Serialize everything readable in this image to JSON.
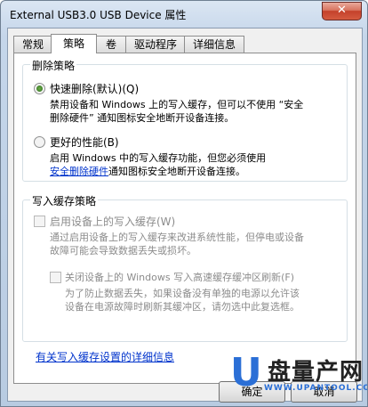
{
  "window": {
    "title": "External USB3.0 USB Device 属性",
    "close_glyph": "✕"
  },
  "tabs": [
    {
      "label": "常规"
    },
    {
      "label": "策略"
    },
    {
      "label": "卷"
    },
    {
      "label": "驱动程序"
    },
    {
      "label": "详细信息"
    }
  ],
  "removal_policy": {
    "title": "删除策略",
    "quick_removal": {
      "label": "快速删除(默认)(Q)",
      "selected": true,
      "desc_line1": "禁用设备和 Windows 上的写入缓存，但可以不使用 “安全",
      "desc_line2": "删除硬件” 通知图标安全地断开设备连接。"
    },
    "better_performance": {
      "label": "更好的性能(B)",
      "selected": false,
      "desc_line1": "启用 Windows 中的写入缓存功能，但您必须使用",
      "desc_link": "安全删除硬件",
      "desc_line2_rest": "通知图标安全地断开设备连接。"
    }
  },
  "write_cache_policy": {
    "title": "写入缓存策略",
    "enable_write_cache": {
      "label": "启用设备上的写入缓存(W)",
      "desc_line1": "通过启用设备上的写入缓存来改进系统性能，但停电或设备",
      "desc_line2": "故障可能会导致数据丢失或损坏。"
    },
    "turn_off_flushing": {
      "label": "关闭设备上的 Windows 写入高速缓存缓冲区刷新(F)",
      "desc_line1": "为了防止数据丢失，如果设备没有单独的电源以允许该",
      "desc_line2": "设备在电源故障时刷新其缓冲区，请勿选中此复选框。"
    }
  },
  "details_link": "有关写入缓存设置的详细信息",
  "buttons": {
    "ok": "确定",
    "cancel": "取消"
  },
  "watermark": {
    "letter": "U",
    "text": "盘量产网",
    "url": "WWW.UPANTOOL.COM"
  }
}
